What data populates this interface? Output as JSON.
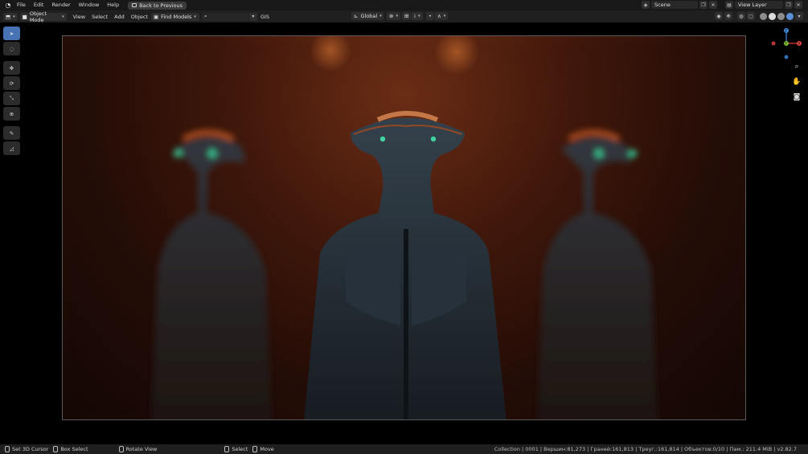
{
  "menubar": {
    "items": [
      "File",
      "Edit",
      "Render",
      "Window",
      "Help"
    ],
    "back_button": "Back to Previous",
    "scene": "Scene",
    "view_layer": "View Layer"
  },
  "header": {
    "mode": "Object Mode",
    "menus": [
      "View",
      "Select",
      "Add",
      "Object"
    ],
    "find_models": "Find Models",
    "gis": "GIS",
    "orientation": "Global"
  },
  "gizmo": {
    "z_label": "Z",
    "x_label": "X",
    "y_label": "Y"
  },
  "statusbar": {
    "set_cursor": "Set 3D Cursor",
    "box_select": "Box Select",
    "rotate_view": "Rotate View",
    "select": "Select",
    "move": "Move",
    "stats": "Collection | 0001 | Вершин:81,273 | Граней:161,813 | Треуг.:161,814 | Объектов:0/10 | Пам.: 211.4 MiB | v2.82.7"
  },
  "colors": {
    "accent": "#4772b3",
    "axis_x": "#e04141",
    "axis_y": "#7dbb2c",
    "axis_z": "#3f8ee0"
  }
}
